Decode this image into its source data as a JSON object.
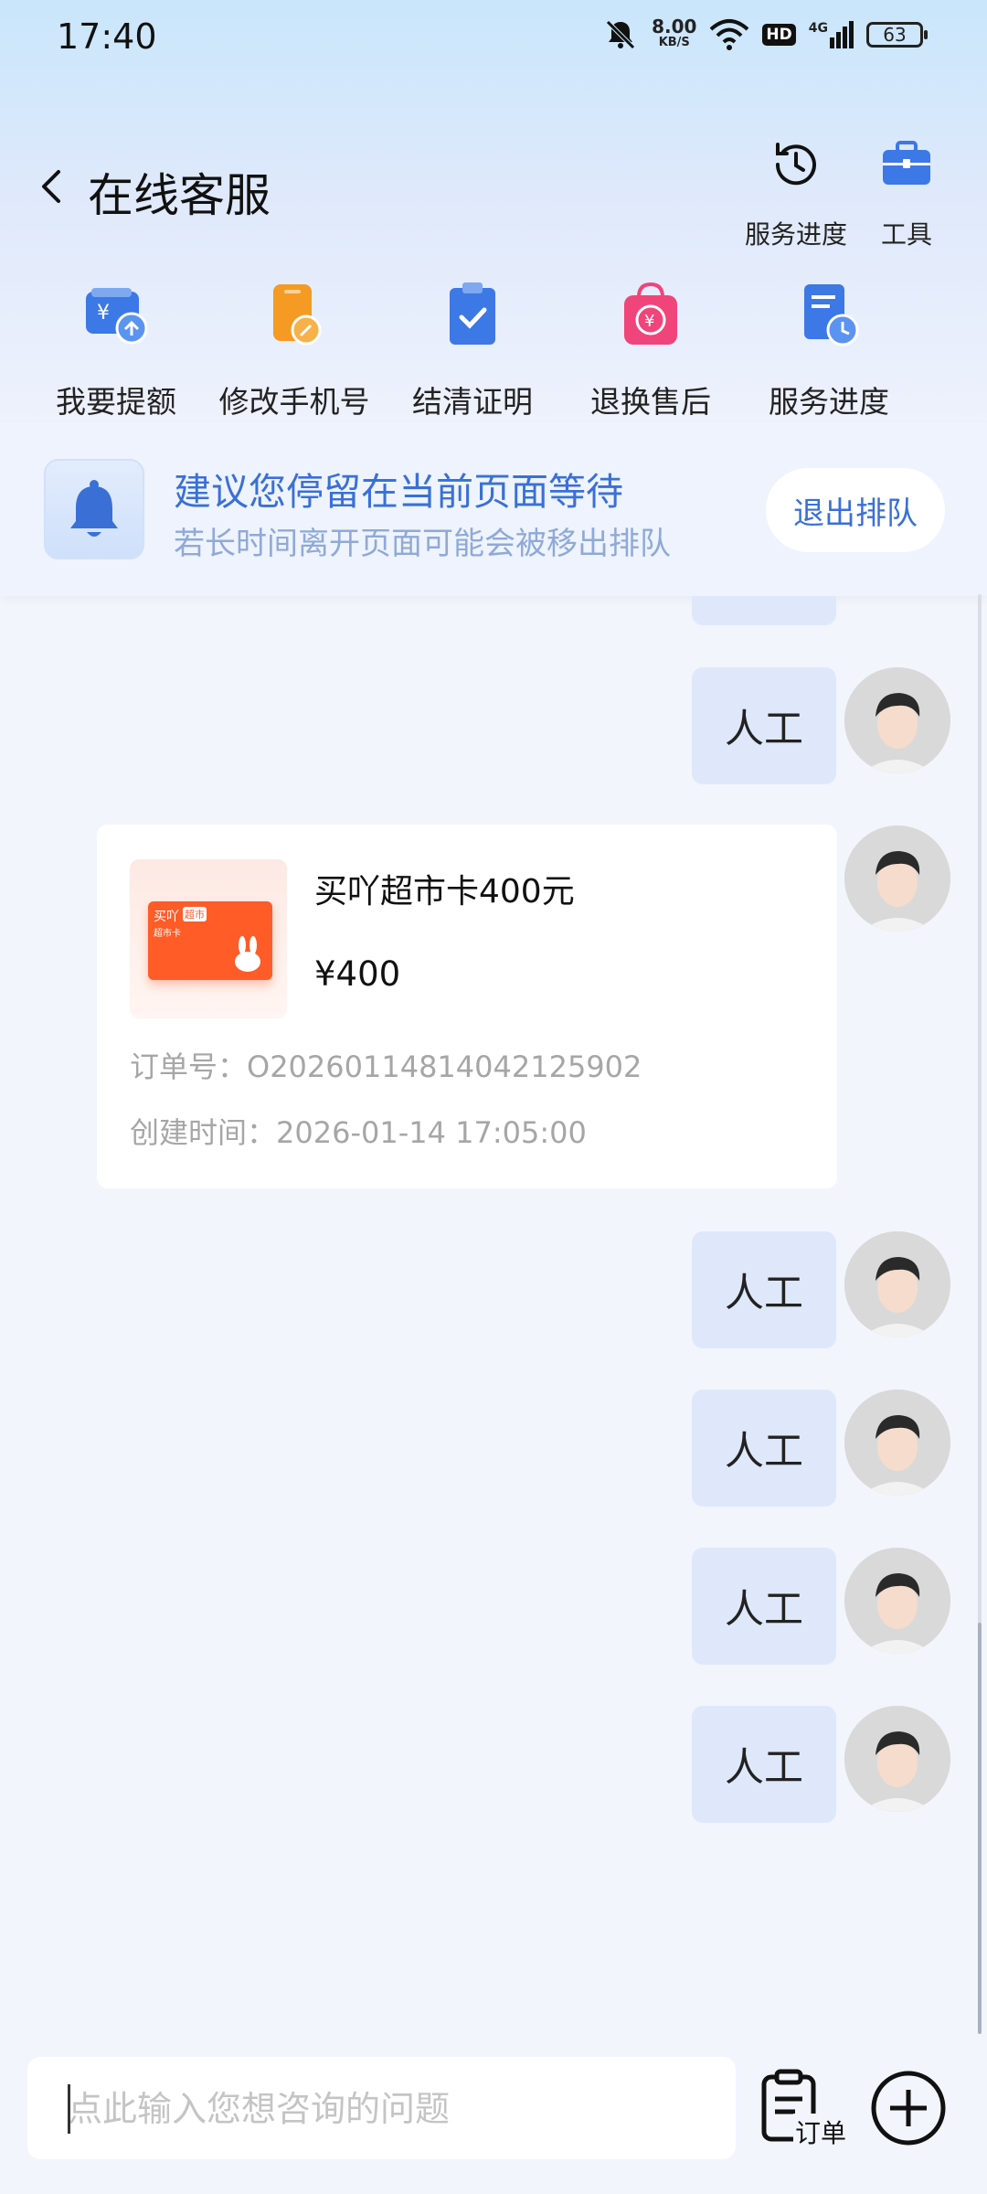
{
  "status": {
    "time": "17:40",
    "speed": "8.00",
    "speed_unit": "KB/S",
    "hd": "HD",
    "net": "4G",
    "battery": "63"
  },
  "header": {
    "title": "在线客服",
    "progress_label": "服务进度",
    "tools_label": "工具"
  },
  "quick_actions": [
    {
      "label": "我要提额",
      "icon": "wallet-upload-icon"
    },
    {
      "label": "修改手机号",
      "icon": "phone-edit-icon"
    },
    {
      "label": "结清证明",
      "icon": "clipboard-check-icon"
    },
    {
      "label": "退换售后",
      "icon": "refund-bag-icon"
    },
    {
      "label": "服务进度",
      "icon": "document-clock-icon"
    }
  ],
  "notice": {
    "title": "建议您停留在当前页面等待",
    "subtitle": "若长时间离开页面可能会被移出排队",
    "exit_button": "退出排队"
  },
  "messages": {
    "manual": "人工"
  },
  "order_card": {
    "thumb_brand": "买吖",
    "thumb_tag": "超市",
    "thumb_sub": "超市卡",
    "name": "买吖超市卡400元",
    "price": "¥400",
    "order_no": "订单号：O20260114814042125902",
    "created": "创建时间：2026-01-14 17:05:00"
  },
  "input": {
    "placeholder": "点此输入您想咨询的问题",
    "order_label": "订单"
  },
  "colors": {
    "accent": "#3a70d6",
    "bubble": "#dfe8fb",
    "icon_blue": "#3c78e6",
    "icon_orange": "#f59a23",
    "icon_pink": "#f0457a"
  }
}
